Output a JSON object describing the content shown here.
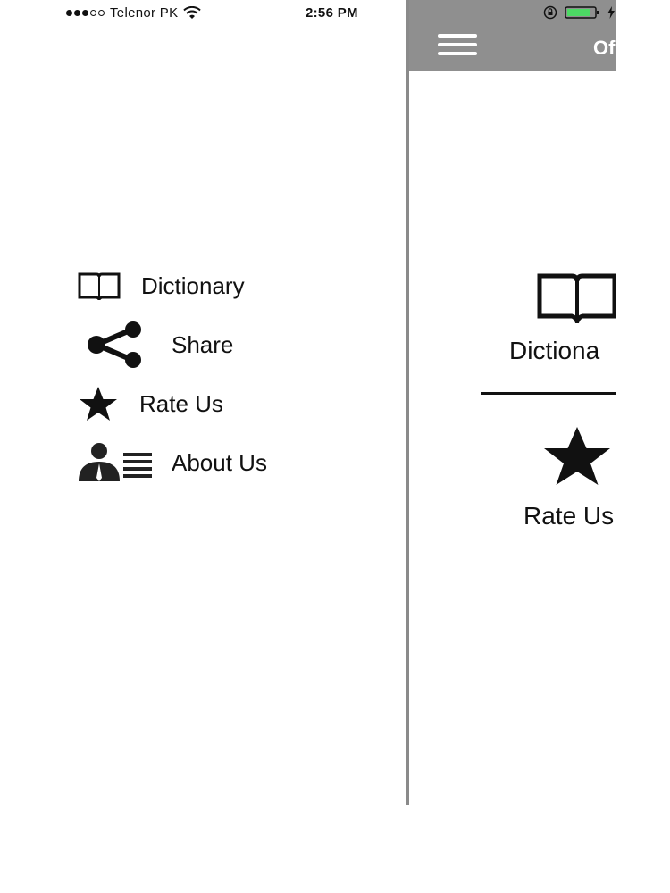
{
  "status_bar": {
    "carrier": "Telenor PK",
    "time": "2:56 PM",
    "signal_bars_filled": 3,
    "signal_bars_total": 5,
    "battery_color": "#4cd964"
  },
  "drawer": {
    "items": [
      {
        "label": "Dictionary",
        "icon": "book-icon"
      },
      {
        "label": "Share",
        "icon": "share-icon"
      },
      {
        "label": "Rate Us",
        "icon": "star-icon"
      },
      {
        "label": "About Us",
        "icon": "about-us-icon"
      }
    ]
  },
  "main": {
    "navbar_title": "Of",
    "navbar_color": "#8f8f8f",
    "tiles": [
      {
        "label": "Dictiona",
        "icon": "book-icon"
      },
      {
        "label": "Rate Us",
        "icon": "star-icon"
      }
    ]
  }
}
